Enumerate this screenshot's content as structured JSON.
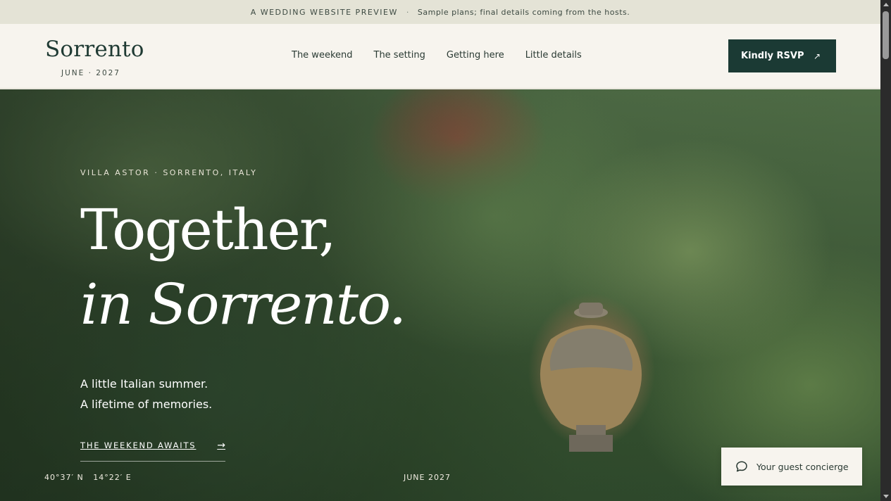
{
  "topbar": {
    "tag": "A WEDDING WEBSITE PREVIEW",
    "separator": "·",
    "note": "Sample plans; final details coming from the hosts."
  },
  "header": {
    "logo_name": "Sorrento",
    "logo_date": "JUNE · 2027",
    "nav": [
      "The weekend",
      "The setting",
      "Getting here",
      "Little details"
    ],
    "rsvp_label": "Kindly RSVP",
    "rsvp_arrow": "↗"
  },
  "hero": {
    "location": "VILLA ASTOR · SORRENTO, ITALY",
    "headline_line1": "Together,",
    "headline_line2": "in Sorrento.",
    "tagline_line1": "A little Italian summer.",
    "tagline_line2": "A lifetime of memories.",
    "cta_label": "THE WEEKEND AWAITS",
    "cta_arrow": "→",
    "coordinates": "40°37′ N   14°22′ E",
    "date": "JUNE 2027"
  },
  "concierge": {
    "label": "Your guest concierge",
    "icon": "chat-bubble-icon"
  },
  "colors": {
    "brand_dark": "#1b3a34",
    "background": "#f7f4ee",
    "topbar": "#e4e3d6"
  }
}
